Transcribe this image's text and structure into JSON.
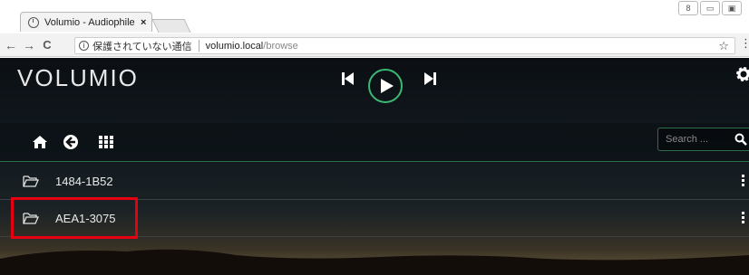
{
  "browser": {
    "tab_title": "Volumio - Audiophile M",
    "tab_close": "×",
    "window_buttons": [
      "8",
      "▭",
      "▣"
    ],
    "nav": {
      "back": "←",
      "forward": "→",
      "reload": "C"
    },
    "address": {
      "info_glyph": "i",
      "security_text": "保護されていない通信",
      "host": "volumio.local",
      "path": "/browse"
    },
    "star": "☆",
    "menu": "⋮"
  },
  "app": {
    "logo": "VOLUMIO",
    "transport": {
      "prev_icon": "skip-previous-icon",
      "play_icon": "play-icon",
      "next_icon": "skip-next-icon"
    },
    "settings_icon": "gear-icon",
    "toolbar": {
      "home_icon": "home-icon",
      "back_icon": "back-arrow-icon",
      "grid_icon": "grid-icon"
    },
    "search": {
      "placeholder": "Search ..."
    },
    "accent_color": "#3db774",
    "folders": [
      {
        "name": "1484-1B52",
        "icon": "folder-open-icon"
      },
      {
        "name": "AEA1-3075",
        "icon": "folder-open-icon"
      }
    ],
    "annotation_color": "#e60012"
  }
}
